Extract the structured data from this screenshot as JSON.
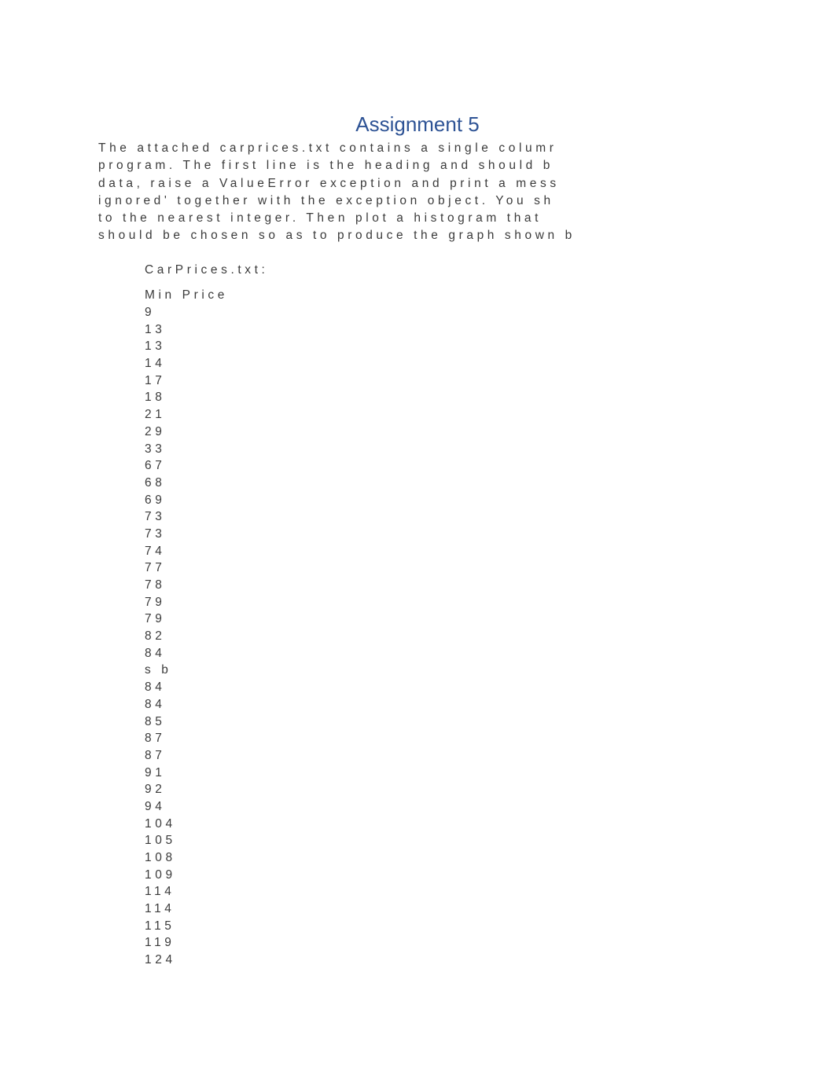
{
  "document": {
    "title": "Assignment 5",
    "title_color": "#2E5395",
    "body_color": "#3b3b3b",
    "background_color": "#ffffff"
  },
  "paragraph": {
    "lines": [
      "The attached carprices.txt contains a single columr",
      "program. The first line is the heading and should b",
      "data, raise a ValueError exception and print a mess",
      "ignored' together with the exception object. You sh",
      "to the nearest integer. Then plot a histogram that",
      "should be chosen so as to produce the graph shown b"
    ]
  },
  "file_section": {
    "file_label": "CarPrices.txt:",
    "column_header": "Min Price",
    "values": [
      "9",
      "13",
      "13",
      "14",
      "17",
      "18",
      "21",
      "29",
      "33",
      "67",
      "68",
      "69",
      "73",
      "73",
      "74",
      "77",
      "78",
      "79",
      "79",
      "82",
      "84",
      "s b",
      "84",
      "84",
      "85",
      "87",
      "87",
      "91",
      "92",
      "94",
      "104",
      "105",
      "108",
      "109",
      "114",
      "114",
      "115",
      "119",
      "124"
    ]
  }
}
